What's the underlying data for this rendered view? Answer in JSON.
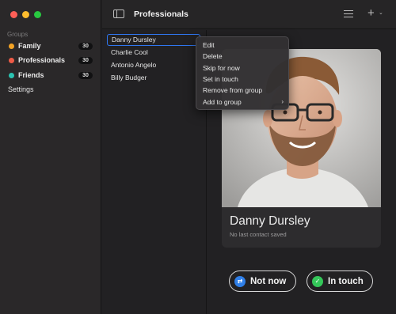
{
  "sidebar": {
    "section_title": "Groups",
    "groups": [
      {
        "label": "Family",
        "count": "30",
        "color": "#f3a325"
      },
      {
        "label": "Professionals",
        "count": "30",
        "color": "#ee5b47"
      },
      {
        "label": "Friends",
        "count": "30",
        "color": "#2bc3b1"
      }
    ],
    "settings_label": "Settings"
  },
  "header": {
    "title": "Professionals"
  },
  "contacts": [
    "Danny Dursley",
    "Charlie Cool",
    "Antonio Angelo",
    "Billy Budger"
  ],
  "context_menu": {
    "items": [
      "Edit",
      "Delete",
      "Skip for now",
      "Set in touch",
      "Remove from group",
      "Add to group"
    ],
    "submenu_arrow": "›"
  },
  "detail": {
    "name": "Danny Dursley",
    "subtitle": "No last contact saved",
    "not_now_label": "Not now",
    "in_touch_label": "In touch"
  },
  "colors": {
    "accent": "#2f76f0",
    "not_now_icon": "#2f7fe8",
    "in_touch_icon": "#34c759"
  }
}
